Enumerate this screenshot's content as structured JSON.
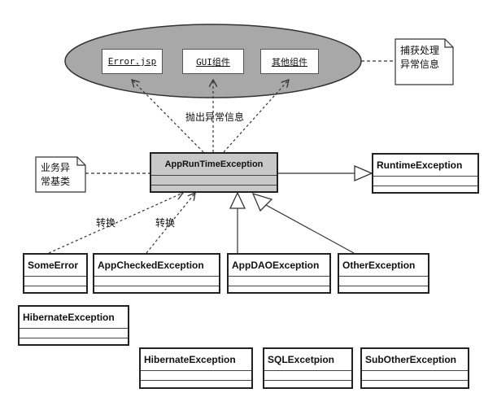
{
  "components": {
    "error_jsp": "Error.jsp",
    "gui": "GUI组件",
    "other": "其他组件"
  },
  "notes": {
    "catch_handle_line1": "捕获处理",
    "catch_handle_line2": "异常信息",
    "business_line1": "业务异",
    "business_line2": "常基类"
  },
  "labels": {
    "throw_info": "抛出异常信息",
    "convert_1": "转换",
    "convert_2": "转换"
  },
  "classes": {
    "app_runtime": "AppRunTimeException",
    "runtime": "RuntimeException",
    "some_error": "SomeError",
    "app_checked": "AppCheckedException",
    "app_dao": "AppDAOException",
    "other": "OtherException",
    "hibernate_1": "HibernateException",
    "hibernate_2": "HibernateException",
    "sql": "SQLExcetpion",
    "sub_other": "SubOtherException"
  },
  "colors": {
    "ellipse_fill": "#a8a8a8",
    "core_fill": "#c8c8c8",
    "line": "#333333"
  }
}
